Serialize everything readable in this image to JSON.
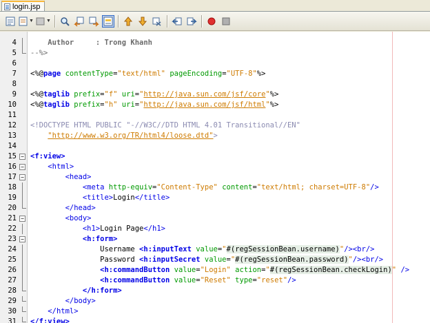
{
  "tab": {
    "title": "login.jsp"
  },
  "toolbar": {
    "buttons": [
      {
        "name": "back-to-edit-icon",
        "glyph": "▤"
      },
      {
        "name": "history-icon",
        "glyph": "▣"
      },
      {
        "name": "bookmark-icon",
        "glyph": "▥"
      },
      {
        "name": "find-icon",
        "glyph": "⌕"
      },
      {
        "name": "find-previous-icon",
        "glyph": "⇦"
      },
      {
        "name": "find-next-icon",
        "glyph": "⇨"
      },
      {
        "name": "toggle-highlight-icon",
        "glyph": "▦"
      },
      {
        "name": "previous-bookmark-icon",
        "glyph": "⇧"
      },
      {
        "name": "next-bookmark-icon",
        "glyph": "⇩"
      },
      {
        "name": "toggle-bookmark-icon",
        "glyph": "⇄"
      },
      {
        "name": "shift-left-icon",
        "glyph": "⇤"
      },
      {
        "name": "shift-right-icon",
        "glyph": "⇥"
      },
      {
        "name": "start-macro-icon",
        "glyph": "●"
      },
      {
        "name": "stop-macro-icon",
        "glyph": "■"
      }
    ]
  },
  "colors": {
    "tag": "#0000e6",
    "attribute": "#009900",
    "string": "#ce7b00",
    "comment": "#6b6b6b",
    "macro_record": "#e03030"
  },
  "editor": {
    "lines": [
      {
        "n": "4",
        "segs": [
          [
            "comment-bold",
            "    Author     : Trong Khanh"
          ]
        ]
      },
      {
        "n": "5",
        "segs": [
          [
            "comment",
            "--%>"
          ]
        ]
      },
      {
        "n": "6",
        "segs": [
          [
            "",
            ""
          ]
        ]
      },
      {
        "n": "7",
        "segs": [
          [
            "dir",
            "<%@"
          ],
          [
            "kw",
            "page"
          ],
          [
            "",
            " "
          ],
          [
            "attr",
            "contentType"
          ],
          [
            "",
            "="
          ],
          [
            "str",
            "\"text/html\""
          ],
          [
            "",
            " "
          ],
          [
            "attr",
            "pageEncoding"
          ],
          [
            "",
            "="
          ],
          [
            "str",
            "\"UTF-8\""
          ],
          [
            "dir",
            "%>"
          ]
        ]
      },
      {
        "n": "8",
        "segs": [
          [
            "",
            ""
          ]
        ]
      },
      {
        "n": "9",
        "segs": [
          [
            "dir",
            "<%@"
          ],
          [
            "kw",
            "taglib"
          ],
          [
            "",
            " "
          ],
          [
            "attr",
            "prefix"
          ],
          [
            "",
            "="
          ],
          [
            "str",
            "\"f\""
          ],
          [
            "",
            " "
          ],
          [
            "attr",
            "uri"
          ],
          [
            "",
            "="
          ],
          [
            "str",
            "\""
          ],
          [
            "url",
            "http://java.sun.com/jsf/core"
          ],
          [
            "str",
            "\""
          ],
          [
            "dir",
            "%>"
          ]
        ]
      },
      {
        "n": "10",
        "segs": [
          [
            "dir",
            "<%@"
          ],
          [
            "kw",
            "taglib"
          ],
          [
            "",
            " "
          ],
          [
            "attr",
            "prefix"
          ],
          [
            "",
            "="
          ],
          [
            "str",
            "\"h\""
          ],
          [
            "",
            " "
          ],
          [
            "attr",
            "uri"
          ],
          [
            "",
            "="
          ],
          [
            "str",
            "\""
          ],
          [
            "url",
            "http://java.sun.com/jsf/html"
          ],
          [
            "str",
            "\""
          ],
          [
            "dir",
            "%>"
          ]
        ]
      },
      {
        "n": "11",
        "segs": [
          [
            "",
            ""
          ]
        ]
      },
      {
        "n": "12",
        "segs": [
          [
            "doctype",
            "<!DOCTYPE HTML PUBLIC \"-//W3C//DTD HTML 4.01 Transitional//EN\""
          ]
        ]
      },
      {
        "n": "13",
        "segs": [
          [
            "doctype",
            "    "
          ],
          [
            "url",
            "\"http://www.w3.org/TR/html4/loose.dtd\""
          ],
          [
            "doctype",
            ">"
          ]
        ]
      },
      {
        "n": "14",
        "segs": [
          [
            "",
            ""
          ]
        ]
      },
      {
        "n": "15",
        "segs": [
          [
            "tagb",
            "<f:view>"
          ]
        ]
      },
      {
        "n": "16",
        "segs": [
          [
            "",
            "    "
          ],
          [
            "tag",
            "<html>"
          ]
        ]
      },
      {
        "n": "17",
        "segs": [
          [
            "",
            "        "
          ],
          [
            "tag",
            "<head>"
          ]
        ]
      },
      {
        "n": "18",
        "segs": [
          [
            "",
            "            "
          ],
          [
            "tag",
            "<meta"
          ],
          [
            "",
            " "
          ],
          [
            "attr",
            "http-equiv"
          ],
          [
            "",
            "="
          ],
          [
            "str",
            "\"Content-Type\""
          ],
          [
            "",
            " "
          ],
          [
            "attr",
            "content"
          ],
          [
            "",
            "="
          ],
          [
            "str",
            "\"text/html; charset=UTF-8\""
          ],
          [
            "tag",
            "/>"
          ]
        ]
      },
      {
        "n": "19",
        "segs": [
          [
            "",
            "            "
          ],
          [
            "tag",
            "<title>"
          ],
          [
            "",
            "Login"
          ],
          [
            "tag",
            "</title>"
          ]
        ]
      },
      {
        "n": "20",
        "segs": [
          [
            "",
            "        "
          ],
          [
            "tag",
            "</head>"
          ]
        ]
      },
      {
        "n": "21",
        "segs": [
          [
            "",
            "        "
          ],
          [
            "tag",
            "<body>"
          ]
        ]
      },
      {
        "n": "22",
        "segs": [
          [
            "",
            "            "
          ],
          [
            "tag",
            "<h1>"
          ],
          [
            "",
            "Login Page"
          ],
          [
            "tag",
            "</h1>"
          ]
        ]
      },
      {
        "n": "23",
        "segs": [
          [
            "",
            "            "
          ],
          [
            "tagb",
            "<h:form>"
          ]
        ]
      },
      {
        "n": "24",
        "segs": [
          [
            "",
            "                Username "
          ],
          [
            "tagb",
            "<h:inputText"
          ],
          [
            "",
            " "
          ],
          [
            "attr",
            "value"
          ],
          [
            "",
            "="
          ],
          [
            "str",
            "\""
          ],
          [
            "hl",
            "#(regSessionBean.username)"
          ],
          [
            "str",
            "\""
          ],
          [
            "tag",
            "/>"
          ],
          [
            "tag",
            "<br/>"
          ]
        ]
      },
      {
        "n": "25",
        "segs": [
          [
            "",
            "                Password "
          ],
          [
            "tagb",
            "<h:inputSecret"
          ],
          [
            "",
            " "
          ],
          [
            "attr",
            "value"
          ],
          [
            "",
            "="
          ],
          [
            "str",
            "\""
          ],
          [
            "hl",
            "#(regSessionBean.password)"
          ],
          [
            "str",
            "\""
          ],
          [
            "tag",
            "/>"
          ],
          [
            "tag",
            "<br/>"
          ]
        ]
      },
      {
        "n": "26",
        "segs": [
          [
            "",
            "                "
          ],
          [
            "tagb",
            "<h:commandButton"
          ],
          [
            "",
            " "
          ],
          [
            "attr",
            "value"
          ],
          [
            "",
            "="
          ],
          [
            "str",
            "\"Login\""
          ],
          [
            "",
            " "
          ],
          [
            "attr",
            "action"
          ],
          [
            "",
            "="
          ],
          [
            "str",
            "\""
          ],
          [
            "hl",
            "#(regSessionBean.checkLogin)"
          ],
          [
            "str",
            "\""
          ],
          [
            "",
            " "
          ],
          [
            "tag",
            "/>"
          ]
        ]
      },
      {
        "n": "27",
        "segs": [
          [
            "",
            "                "
          ],
          [
            "tagb",
            "<h:commandButton"
          ],
          [
            "",
            " "
          ],
          [
            "attr",
            "value"
          ],
          [
            "",
            "="
          ],
          [
            "str",
            "\"Reset\""
          ],
          [
            "",
            " "
          ],
          [
            "attr",
            "type"
          ],
          [
            "",
            "="
          ],
          [
            "str",
            "\"reset\""
          ],
          [
            "tag",
            "/>"
          ]
        ]
      },
      {
        "n": "28",
        "segs": [
          [
            "",
            "            "
          ],
          [
            "tagb",
            "</h:form>"
          ]
        ]
      },
      {
        "n": "29",
        "segs": [
          [
            "",
            "        "
          ],
          [
            "tag",
            "</body>"
          ]
        ]
      },
      {
        "n": "30",
        "segs": [
          [
            "",
            "    "
          ],
          [
            "tag",
            "</html>"
          ]
        ]
      },
      {
        "n": "31",
        "segs": [
          [
            "tagb",
            "</f:view>"
          ]
        ]
      }
    ],
    "folds": {
      "4": "bar",
      "5": "end",
      "15": "box",
      "16": "box",
      "17": "box",
      "18": "bar",
      "19": "bar",
      "20": "end",
      "21": "box",
      "22": "bar",
      "23": "box",
      "24": "bar",
      "25": "bar",
      "26": "bar",
      "27": "bar",
      "28": "end",
      "29": "end",
      "30": "end",
      "31": "end"
    }
  }
}
